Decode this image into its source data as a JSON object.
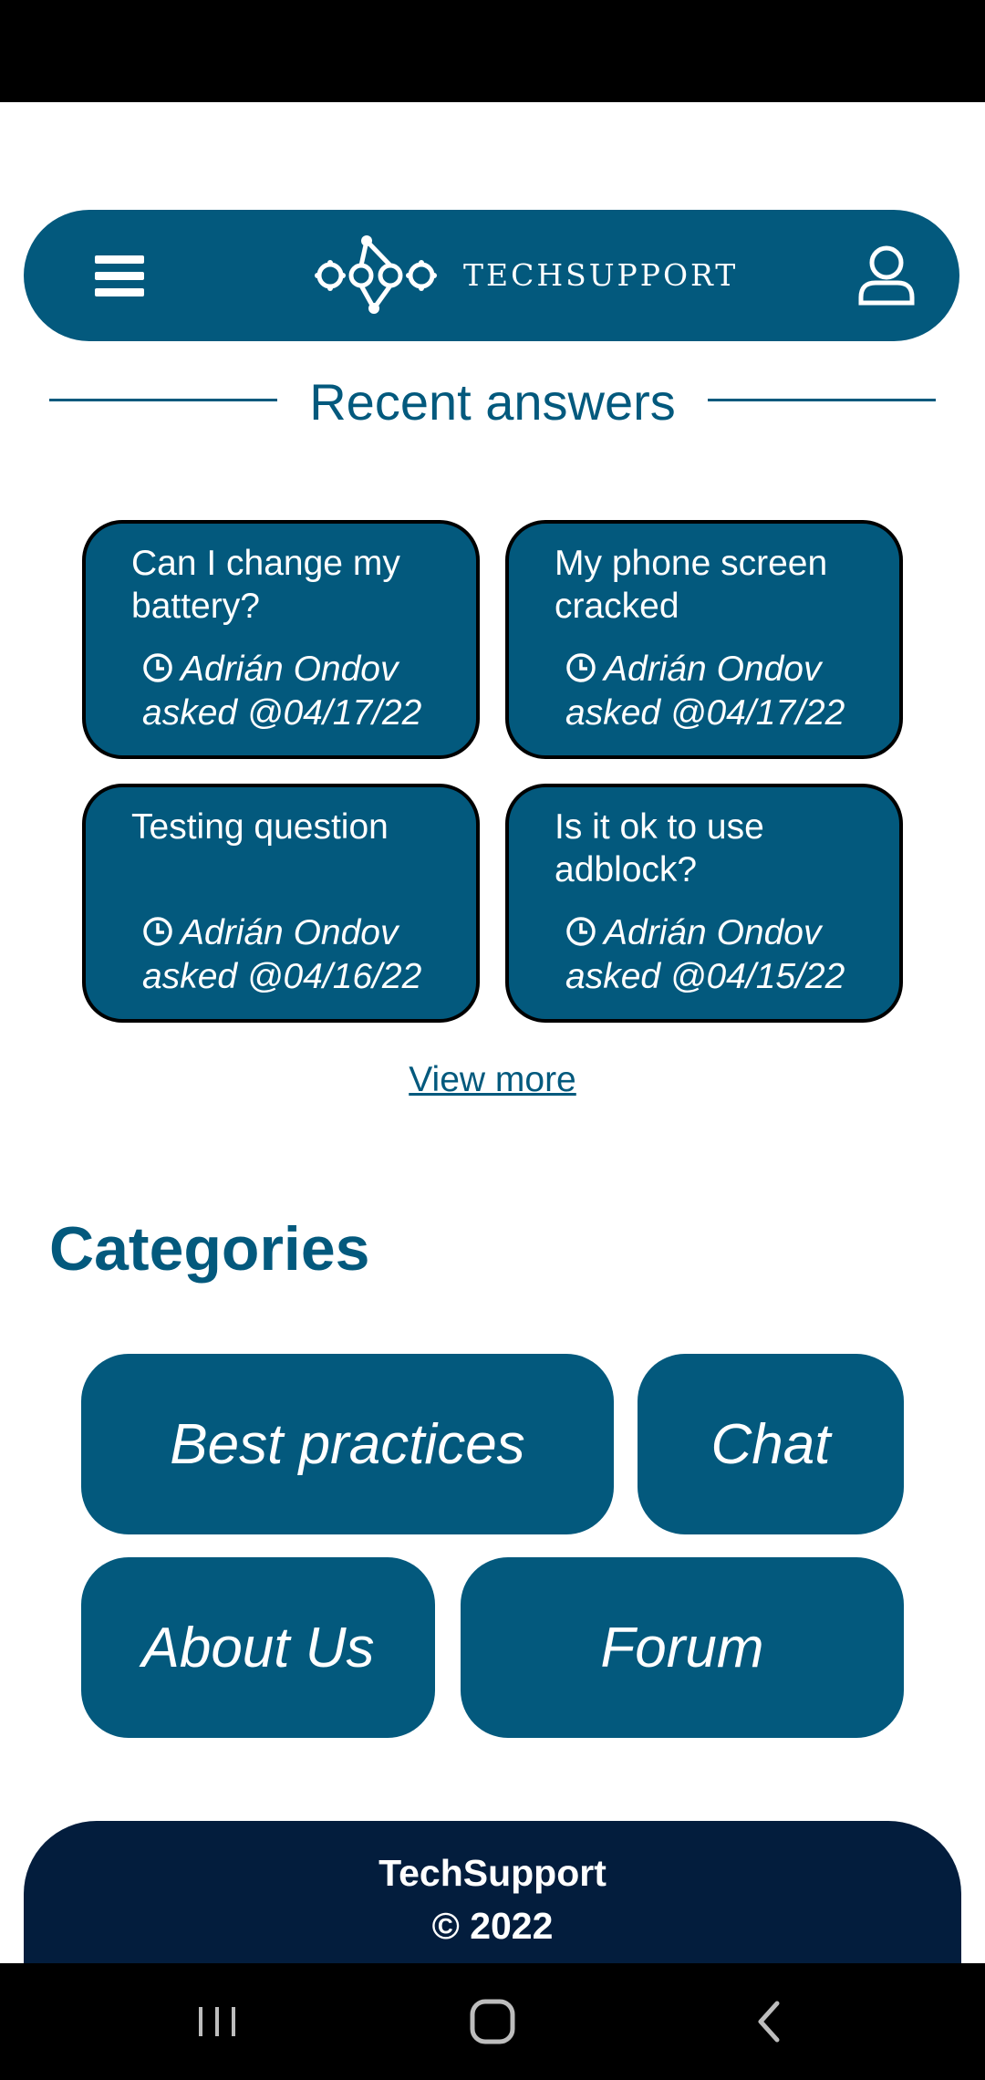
{
  "app": {
    "brand_name": "TECHSUPPORT",
    "brand_color": "#03597d",
    "footer_color": "#031d3d"
  },
  "header": {
    "menu_icon": "hamburger-menu-icon",
    "user_icon": "user-profile-icon"
  },
  "recent": {
    "title": "Recent answers",
    "questions": [
      {
        "title": "Can I change my battery?",
        "author": "Adrián Ondov",
        "asked": "asked @04/17/22"
      },
      {
        "title": "My phone screen cracked",
        "author": "Adrián Ondov",
        "asked": "asked @04/17/22"
      },
      {
        "title": "Testing question",
        "author": "Adrián Ondov",
        "asked": "asked @04/16/22"
      },
      {
        "title": "Is it ok to use adblock?",
        "author": "Adrián Ondov",
        "asked": "asked @04/15/22"
      }
    ],
    "view_more": "View more"
  },
  "categories": {
    "title": "Categories",
    "items": [
      "Best practices",
      "Chat",
      "About Us",
      "Forum"
    ]
  },
  "footer": {
    "name": "TechSupport",
    "copyright": "© 2022"
  }
}
